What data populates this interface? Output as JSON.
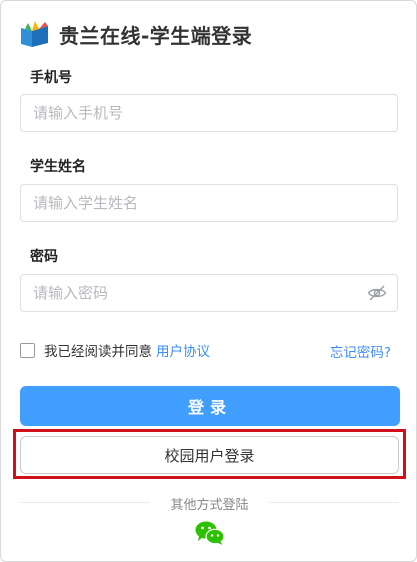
{
  "header": {
    "title": "贵兰在线-学生端登录",
    "logo_icon": "book-logo-icon"
  },
  "form": {
    "phone": {
      "label": "手机号",
      "placeholder": "请输入手机号",
      "value": ""
    },
    "student_name": {
      "label": "学生姓名",
      "placeholder": "请输入学生姓名",
      "value": ""
    },
    "password": {
      "label": "密码",
      "placeholder": "请输入密码",
      "value": "",
      "toggle_icon": "eye-hidden-icon"
    },
    "agreement": {
      "checked": false,
      "text": "我已经阅读并同意",
      "link": "用户协议"
    },
    "forgot_password": "忘记密码?"
  },
  "buttons": {
    "login": "登录",
    "campus_login": "校园用户登录"
  },
  "other_methods": {
    "label": "其他方式登陆",
    "wechat_icon": "wechat-icon"
  },
  "colors": {
    "primary": "#409eff",
    "link": "#3e8ef7",
    "highlight_border": "#d0111b",
    "wechat": "#2dc100"
  }
}
